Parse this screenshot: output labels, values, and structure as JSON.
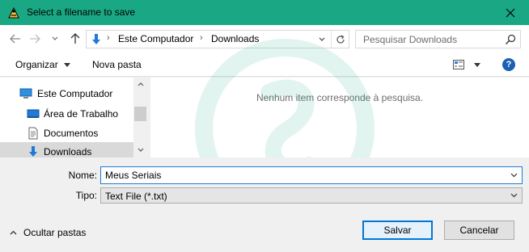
{
  "window": {
    "title": "Select a filename to save",
    "accent_color": "#1aa884"
  },
  "nav": {
    "back_icon": "arrow-left-icon",
    "forward_icon": "arrow-right-icon",
    "recent_icon": "chevron-down-icon",
    "up_icon": "arrow-up-icon",
    "breadcrumb": [
      "Este Computador",
      "Downloads"
    ],
    "search_placeholder": "Pesquisar Downloads"
  },
  "toolbar": {
    "organize_label": "Organizar",
    "new_folder_label": "Nova pasta",
    "help_label": "?"
  },
  "sidebar": {
    "items": [
      {
        "label": "Este Computador",
        "icon": "computer-icon"
      },
      {
        "label": "Área de Trabalho",
        "icon": "desktop-icon"
      },
      {
        "label": "Documentos",
        "icon": "document-icon"
      },
      {
        "label": "Downloads",
        "icon": "downloads-icon",
        "selected": true
      }
    ]
  },
  "files": {
    "empty_message": "Nenhum item corresponde à pesquisa."
  },
  "form": {
    "name_label": "Nome:",
    "name_value": "Meus Seriais",
    "type_label": "Tipo:",
    "type_value": "Text File (*.txt)"
  },
  "footer": {
    "hide_folders_label": "Ocultar pastas",
    "save_label": "Salvar",
    "cancel_label": "Cancelar"
  }
}
